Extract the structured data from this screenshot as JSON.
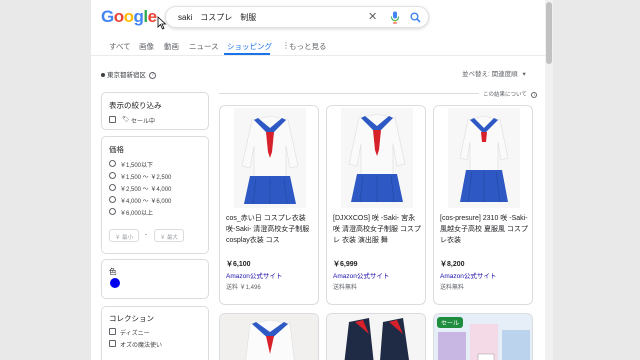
{
  "search": {
    "query": "saki　コスプレ　制服"
  },
  "logo": {
    "letters": [
      "G",
      "o",
      "o",
      "g",
      "l",
      "e"
    ],
    "colors": [
      "#4285f4",
      "#ea4335",
      "#fbbc05",
      "#4285f4",
      "#34a853",
      "#ea4335"
    ]
  },
  "tabs": [
    {
      "label": "すべて"
    },
    {
      "label": "画像"
    },
    {
      "label": "動画"
    },
    {
      "label": "ニュース"
    },
    {
      "label": "ショッピング"
    },
    {
      "label": "もっと見る"
    }
  ],
  "location": "東京都新宿区",
  "sort_label": "並べ替え: 関連度順",
  "about_label": "この結果について",
  "filters": {
    "display": {
      "title": "表示の絞り込み",
      "sale_label": "セール中"
    },
    "price": {
      "title": "価格",
      "options": [
        "￥1,500以下",
        "￥1,500 ～ ￥2,500",
        "￥2,500 ～ ￥4,000",
        "￥4,000 ～ ￥6,000",
        "￥6,000以上"
      ],
      "min_placeholder": "￥ 最小",
      "max_placeholder": "￥ 最大",
      "separator": "-"
    },
    "color": {
      "title": "色"
    },
    "collection": {
      "title": "コレクション",
      "options": [
        "ディズニー",
        "オズの魔法使い"
      ]
    }
  },
  "products": [
    {
      "title": "cos_赤い日 コスプレ衣装 咲-Saki- 清澄高校女子制服 cosplay衣装 コス",
      "price": "￥6,100",
      "store": "Amazon公式サイト",
      "shipping": "送料 ￥1,496"
    },
    {
      "title": "[DJXXCOS] 咲 -Saki- 宮永 咲 清澄高校女子制服 コスプレ 衣装 演出服 舞",
      "price": "￥6,999",
      "store": "Amazon公式サイト",
      "shipping": "送料無料"
    },
    {
      "title": "[cos-presure] 2310 咲 -Saki- 風越女子高校 夏服風 コスプレ衣装",
      "price": "￥8,200",
      "store": "Amazon公式サイト",
      "shipping": "送料無料"
    }
  ],
  "sale_badge": "セール",
  "colors": {
    "accent": "#1a73e8",
    "link": "#1a0dab",
    "uniform_blue": "#2e58c4",
    "ribbon_red": "#d6202a"
  }
}
